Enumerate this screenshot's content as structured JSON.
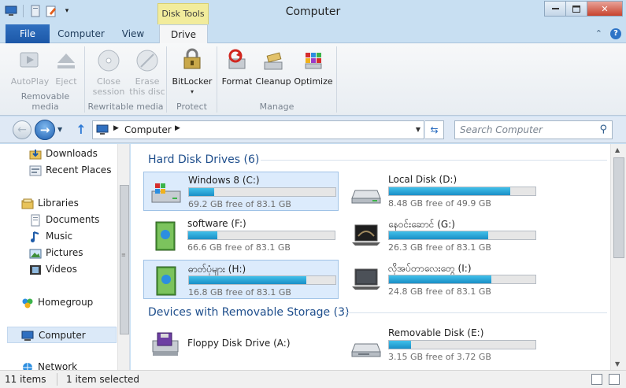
{
  "window": {
    "title": "Computer",
    "context_tab_label": "Disk Tools"
  },
  "tabs": [
    {
      "label": "File"
    },
    {
      "label": "Computer"
    },
    {
      "label": "View"
    },
    {
      "label": "Drive"
    }
  ],
  "ribbon": {
    "groups": [
      {
        "name": "Removable media",
        "buttons": [
          {
            "label": "AutoPlay",
            "disabled": true
          },
          {
            "label": "Eject",
            "disabled": true
          }
        ]
      },
      {
        "name": "Rewritable media",
        "buttons": [
          {
            "label": "Close session",
            "line1": "Close",
            "line2": "session",
            "disabled": true
          },
          {
            "label": "Erase this disc",
            "line1": "Erase",
            "line2": "this disc",
            "disabled": true
          }
        ]
      },
      {
        "name": "Protect",
        "buttons": [
          {
            "label": "BitLocker"
          }
        ]
      },
      {
        "name": "Manage",
        "buttons": [
          {
            "label": "Format"
          },
          {
            "label": "Cleanup"
          },
          {
            "label": "Optimize"
          }
        ]
      }
    ]
  },
  "address": {
    "crumb": "Computer"
  },
  "search": {
    "placeholder": "Search Computer"
  },
  "nav": {
    "items": [
      {
        "label": "Downloads"
      },
      {
        "label": "Recent Places"
      },
      {
        "label": "Libraries"
      },
      {
        "label": "Documents"
      },
      {
        "label": "Music"
      },
      {
        "label": "Pictures"
      },
      {
        "label": "Videos"
      },
      {
        "label": "Homegroup"
      },
      {
        "label": "Computer"
      },
      {
        "label": "Network"
      }
    ]
  },
  "content": {
    "hdd_header": "Hard Disk Drives (6)",
    "removable_header": "Devices with Removable Storage (3)",
    "drives": [
      {
        "name": "Windows 8 (C:)",
        "free": "69.2 GB free of 83.1 GB",
        "used_fraction": 0.17
      },
      {
        "name": "Local Disk (D:)",
        "free": "8.48 GB free of 49.9 GB",
        "used_fraction": 0.83
      },
      {
        "name": "software (F:)",
        "free": "66.6 GB free of 83.1 GB",
        "used_fraction": 0.2
      },
      {
        "name": "နေဝင်းဆောင် (G:)",
        "free": "26.3 GB free of 83.1 GB",
        "used_fraction": 0.68
      },
      {
        "name": "ဓာတ်ပုံများ (H:)",
        "free": "16.8 GB free of 83.1 GB",
        "used_fraction": 0.8
      },
      {
        "name": "လိုအပ်တာလေးတွေ (I:)",
        "free": "24.8 GB free of 83.1 GB",
        "used_fraction": 0.7
      }
    ],
    "removable": [
      {
        "name": "Floppy Disk Drive (A:)"
      },
      {
        "name": "Removable Disk (E:)",
        "free": "3.15 GB free of 3.72 GB",
        "used_fraction": 0.15
      }
    ]
  },
  "status": {
    "items": "11 items",
    "selected": "1 item selected"
  }
}
